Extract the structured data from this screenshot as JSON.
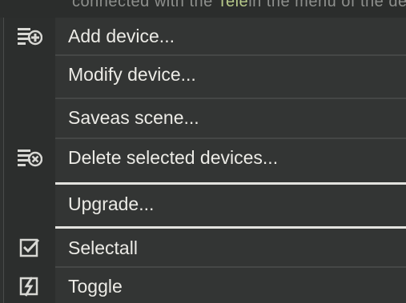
{
  "top_fragment": {
    "left": "connected with the ",
    "highlight": "Tele",
    "right": "in the menu of the dev"
  },
  "menu": {
    "items": [
      {
        "label": "Add device...",
        "icon": "add-device-icon"
      },
      {
        "label": "Modify device...",
        "icon": ""
      },
      {
        "label": "Saveas scene...",
        "icon": ""
      },
      {
        "label": "Delete selected devices...",
        "icon": "delete-devices-icon"
      },
      {
        "label": "Upgrade...",
        "icon": ""
      },
      {
        "label": "Selectall",
        "icon": "select-all-icon"
      },
      {
        "label": "Toggle",
        "icon": "toggle-icon"
      }
    ]
  },
  "colors": {
    "menu_bg": "#333534",
    "gutter_bg": "#2c2e2d",
    "text": "#ecebe6",
    "separator_bright": "#e3e3df"
  }
}
